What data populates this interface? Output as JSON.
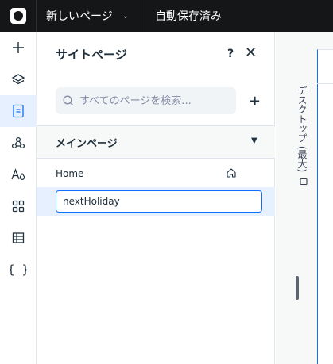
{
  "topbar": {
    "page_selector": "新しいページ",
    "autosave_status": "自動保存済み"
  },
  "toolbar": {
    "items": [
      {
        "icon": "add-icon",
        "active": false
      },
      {
        "icon": "layers-icon",
        "active": false
      },
      {
        "icon": "pages-icon",
        "active": true
      },
      {
        "icon": "design-icon",
        "active": false
      },
      {
        "icon": "theme-icon",
        "active": false
      },
      {
        "icon": "apps-icon",
        "active": false
      },
      {
        "icon": "table-icon",
        "active": false
      },
      {
        "icon": "code-icon",
        "active": false
      }
    ],
    "code_label": "{ }"
  },
  "panel": {
    "title": "サイトページ",
    "help_label": "?",
    "close_label": "✕",
    "search_placeholder": "すべてのページを検索...",
    "add_label": "+",
    "section_title": "メインページ",
    "pages": [
      {
        "label": "Home",
        "is_home": true
      },
      {
        "label": "nextHoliday",
        "editing": true
      }
    ]
  },
  "canvas": {
    "ruler_label": "デスクトップ (最大)"
  }
}
